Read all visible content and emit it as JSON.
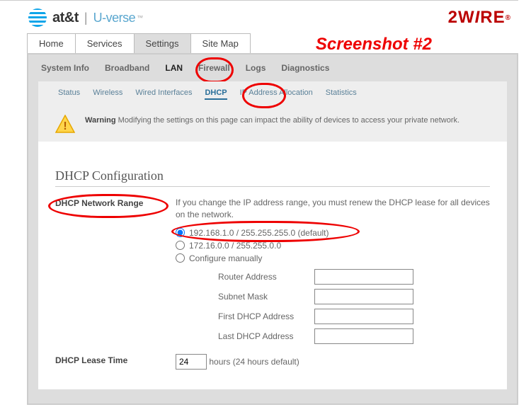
{
  "branding": {
    "att": "at&t",
    "uverse": "U-verse",
    "twowire": "2WIRE"
  },
  "annotation": "Screenshot #2",
  "tabs": {
    "home": "Home",
    "services": "Services",
    "settings": "Settings",
    "sitemap": "Site Map"
  },
  "subtabs": {
    "system": "System Info",
    "broadband": "Broadband",
    "lan": "LAN",
    "firewall": "Firewall",
    "logs": "Logs",
    "diagnostics": "Diagnostics"
  },
  "subsubs": {
    "status": "Status",
    "wireless": "Wireless",
    "wired": "Wired Interfaces",
    "dhcp": "DHCP",
    "ipalloc": "IP Address Allocation",
    "stats": "Statistics"
  },
  "warning": {
    "label": "Warning",
    "text": "Modifying the settings on this page can impact the ability of devices to access your private network."
  },
  "section_title": "DHCP Configuration",
  "range": {
    "label": "DHCP Network Range",
    "note": "If you change the IP address range, you must renew the DHCP lease for all devices on the network.",
    "opt1": "192.168.1.0 / 255.255.255.0 (default)",
    "opt2": "172.16.0.0 / 255.255.0.0",
    "opt3": "Configure manually",
    "router_label": "Router Address",
    "subnet_label": "Subnet Mask",
    "first_label": "First DHCP Address",
    "last_label": "Last DHCP Address"
  },
  "lease": {
    "label": "DHCP Lease Time",
    "value": "24",
    "suffix": "hours (24 hours default)"
  }
}
